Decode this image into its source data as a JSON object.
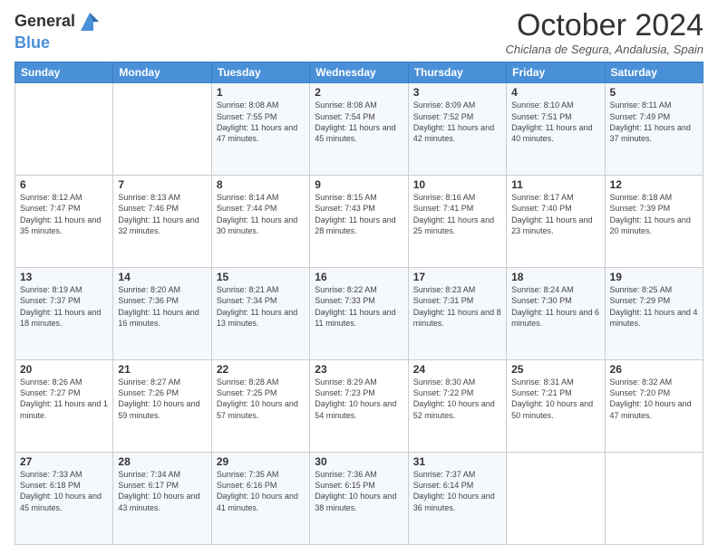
{
  "logo": {
    "line1": "General",
    "line2": "Blue"
  },
  "title": "October 2024",
  "subtitle": "Chiclana de Segura, Andalusia, Spain",
  "headers": [
    "Sunday",
    "Monday",
    "Tuesday",
    "Wednesday",
    "Thursday",
    "Friday",
    "Saturday"
  ],
  "weeks": [
    [
      {
        "day": "",
        "sunrise": "",
        "sunset": "",
        "daylight": ""
      },
      {
        "day": "",
        "sunrise": "",
        "sunset": "",
        "daylight": ""
      },
      {
        "day": "1",
        "sunrise": "Sunrise: 8:08 AM",
        "sunset": "Sunset: 7:55 PM",
        "daylight": "Daylight: 11 hours and 47 minutes."
      },
      {
        "day": "2",
        "sunrise": "Sunrise: 8:08 AM",
        "sunset": "Sunset: 7:54 PM",
        "daylight": "Daylight: 11 hours and 45 minutes."
      },
      {
        "day": "3",
        "sunrise": "Sunrise: 8:09 AM",
        "sunset": "Sunset: 7:52 PM",
        "daylight": "Daylight: 11 hours and 42 minutes."
      },
      {
        "day": "4",
        "sunrise": "Sunrise: 8:10 AM",
        "sunset": "Sunset: 7:51 PM",
        "daylight": "Daylight: 11 hours and 40 minutes."
      },
      {
        "day": "5",
        "sunrise": "Sunrise: 8:11 AM",
        "sunset": "Sunset: 7:49 PM",
        "daylight": "Daylight: 11 hours and 37 minutes."
      }
    ],
    [
      {
        "day": "6",
        "sunrise": "Sunrise: 8:12 AM",
        "sunset": "Sunset: 7:47 PM",
        "daylight": "Daylight: 11 hours and 35 minutes."
      },
      {
        "day": "7",
        "sunrise": "Sunrise: 8:13 AM",
        "sunset": "Sunset: 7:46 PM",
        "daylight": "Daylight: 11 hours and 32 minutes."
      },
      {
        "day": "8",
        "sunrise": "Sunrise: 8:14 AM",
        "sunset": "Sunset: 7:44 PM",
        "daylight": "Daylight: 11 hours and 30 minutes."
      },
      {
        "day": "9",
        "sunrise": "Sunrise: 8:15 AM",
        "sunset": "Sunset: 7:43 PM",
        "daylight": "Daylight: 11 hours and 28 minutes."
      },
      {
        "day": "10",
        "sunrise": "Sunrise: 8:16 AM",
        "sunset": "Sunset: 7:41 PM",
        "daylight": "Daylight: 11 hours and 25 minutes."
      },
      {
        "day": "11",
        "sunrise": "Sunrise: 8:17 AM",
        "sunset": "Sunset: 7:40 PM",
        "daylight": "Daylight: 11 hours and 23 minutes."
      },
      {
        "day": "12",
        "sunrise": "Sunrise: 8:18 AM",
        "sunset": "Sunset: 7:39 PM",
        "daylight": "Daylight: 11 hours and 20 minutes."
      }
    ],
    [
      {
        "day": "13",
        "sunrise": "Sunrise: 8:19 AM",
        "sunset": "Sunset: 7:37 PM",
        "daylight": "Daylight: 11 hours and 18 minutes."
      },
      {
        "day": "14",
        "sunrise": "Sunrise: 8:20 AM",
        "sunset": "Sunset: 7:36 PM",
        "daylight": "Daylight: 11 hours and 16 minutes."
      },
      {
        "day": "15",
        "sunrise": "Sunrise: 8:21 AM",
        "sunset": "Sunset: 7:34 PM",
        "daylight": "Daylight: 11 hours and 13 minutes."
      },
      {
        "day": "16",
        "sunrise": "Sunrise: 8:22 AM",
        "sunset": "Sunset: 7:33 PM",
        "daylight": "Daylight: 11 hours and 11 minutes."
      },
      {
        "day": "17",
        "sunrise": "Sunrise: 8:23 AM",
        "sunset": "Sunset: 7:31 PM",
        "daylight": "Daylight: 11 hours and 8 minutes."
      },
      {
        "day": "18",
        "sunrise": "Sunrise: 8:24 AM",
        "sunset": "Sunset: 7:30 PM",
        "daylight": "Daylight: 11 hours and 6 minutes."
      },
      {
        "day": "19",
        "sunrise": "Sunrise: 8:25 AM",
        "sunset": "Sunset: 7:29 PM",
        "daylight": "Daylight: 11 hours and 4 minutes."
      }
    ],
    [
      {
        "day": "20",
        "sunrise": "Sunrise: 8:26 AM",
        "sunset": "Sunset: 7:27 PM",
        "daylight": "Daylight: 11 hours and 1 minute."
      },
      {
        "day": "21",
        "sunrise": "Sunrise: 8:27 AM",
        "sunset": "Sunset: 7:26 PM",
        "daylight": "Daylight: 10 hours and 59 minutes."
      },
      {
        "day": "22",
        "sunrise": "Sunrise: 8:28 AM",
        "sunset": "Sunset: 7:25 PM",
        "daylight": "Daylight: 10 hours and 57 minutes."
      },
      {
        "day": "23",
        "sunrise": "Sunrise: 8:29 AM",
        "sunset": "Sunset: 7:23 PM",
        "daylight": "Daylight: 10 hours and 54 minutes."
      },
      {
        "day": "24",
        "sunrise": "Sunrise: 8:30 AM",
        "sunset": "Sunset: 7:22 PM",
        "daylight": "Daylight: 10 hours and 52 minutes."
      },
      {
        "day": "25",
        "sunrise": "Sunrise: 8:31 AM",
        "sunset": "Sunset: 7:21 PM",
        "daylight": "Daylight: 10 hours and 50 minutes."
      },
      {
        "day": "26",
        "sunrise": "Sunrise: 8:32 AM",
        "sunset": "Sunset: 7:20 PM",
        "daylight": "Daylight: 10 hours and 47 minutes."
      }
    ],
    [
      {
        "day": "27",
        "sunrise": "Sunrise: 7:33 AM",
        "sunset": "Sunset: 6:18 PM",
        "daylight": "Daylight: 10 hours and 45 minutes."
      },
      {
        "day": "28",
        "sunrise": "Sunrise: 7:34 AM",
        "sunset": "Sunset: 6:17 PM",
        "daylight": "Daylight: 10 hours and 43 minutes."
      },
      {
        "day": "29",
        "sunrise": "Sunrise: 7:35 AM",
        "sunset": "Sunset: 6:16 PM",
        "daylight": "Daylight: 10 hours and 41 minutes."
      },
      {
        "day": "30",
        "sunrise": "Sunrise: 7:36 AM",
        "sunset": "Sunset: 6:15 PM",
        "daylight": "Daylight: 10 hours and 38 minutes."
      },
      {
        "day": "31",
        "sunrise": "Sunrise: 7:37 AM",
        "sunset": "Sunset: 6:14 PM",
        "daylight": "Daylight: 10 hours and 36 minutes."
      },
      {
        "day": "",
        "sunrise": "",
        "sunset": "",
        "daylight": ""
      },
      {
        "day": "",
        "sunrise": "",
        "sunset": "",
        "daylight": ""
      }
    ]
  ]
}
